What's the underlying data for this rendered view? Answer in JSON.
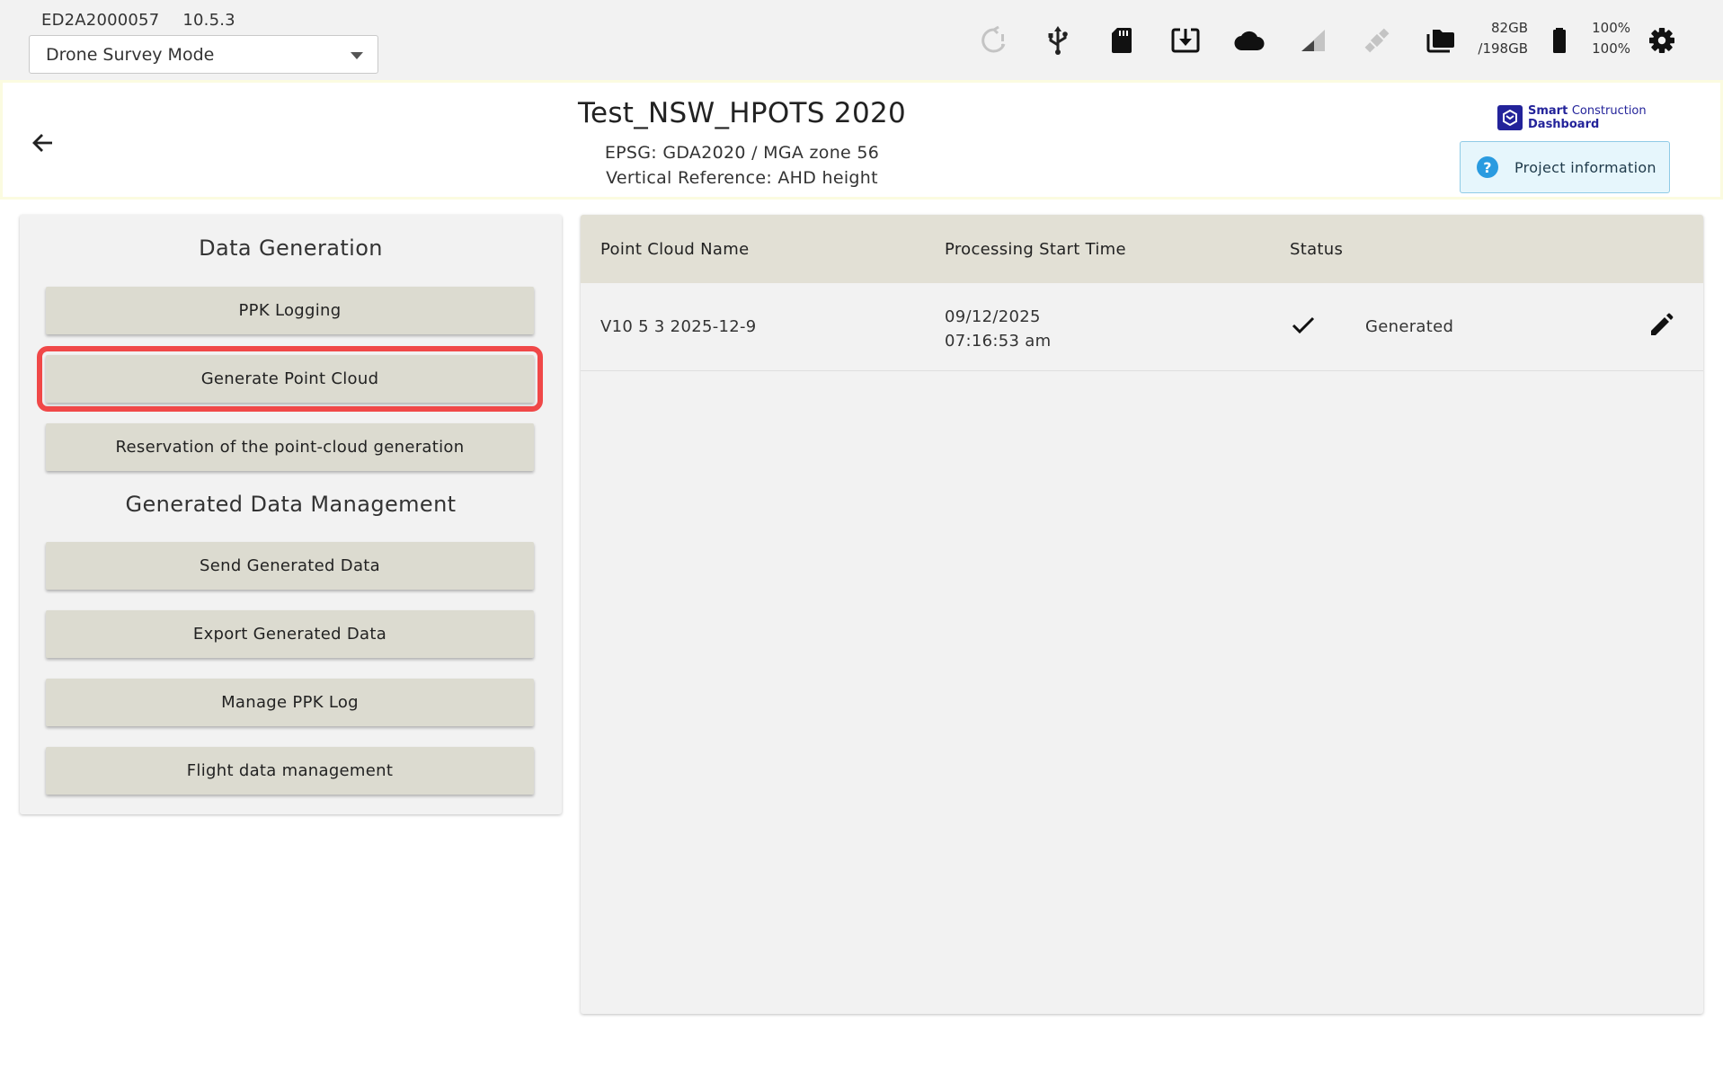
{
  "device": {
    "serial": "ED2A2000057",
    "version": "10.5.3"
  },
  "mode_select": {
    "value": "Drone Survey Mode"
  },
  "status_bar": {
    "icons": [
      "sync-alert-icon",
      "usb-icon",
      "sd-card-icon",
      "download-icon",
      "cloud-icon",
      "signal-icon",
      "satellite-icon",
      "folder-icon",
      "battery-icon",
      "gear-icon"
    ],
    "storage_used": "82GB",
    "storage_total": "/198GB",
    "battery_1": "100%",
    "battery_2": "100%"
  },
  "project": {
    "title": "Test_NSW_HPOTS 2020",
    "epsg": "EPSG: GDA2020 / MGA zone 56",
    "vertical_ref": "Vertical Reference: AHD height"
  },
  "brand": {
    "line1_bold": "Smart",
    "line1_light": "Construction",
    "line2": "Dashboard"
  },
  "project_info_button": {
    "label": "Project information"
  },
  "left_panel": {
    "data_generation_title": "Data Generation",
    "data_generation_buttons": [
      "PPK Logging",
      "Generate Point Cloud",
      "Reservation of the point-cloud generation"
    ],
    "management_title": "Generated Data Management",
    "management_buttons": [
      "Send Generated Data",
      "Export Generated Data",
      "Manage PPK Log",
      "Flight data management"
    ],
    "highlighted_button": "Generate Point Cloud"
  },
  "table": {
    "columns": [
      "Point Cloud Name",
      "Processing Start Time",
      "Status"
    ],
    "rows": [
      {
        "name": "V10 5 3 2025-12-9",
        "start_date": "09/12/2025",
        "start_time": "07:16:53 am",
        "status": "Generated"
      }
    ]
  },
  "colors": {
    "topbar_bg": "#f2f2f2",
    "button_bg": "#dcdbd0",
    "table_header_bg": "#e2e0d5",
    "highlight": "#f04848",
    "info_button_bg": "#e6f6fc",
    "brand": "#23239a"
  }
}
